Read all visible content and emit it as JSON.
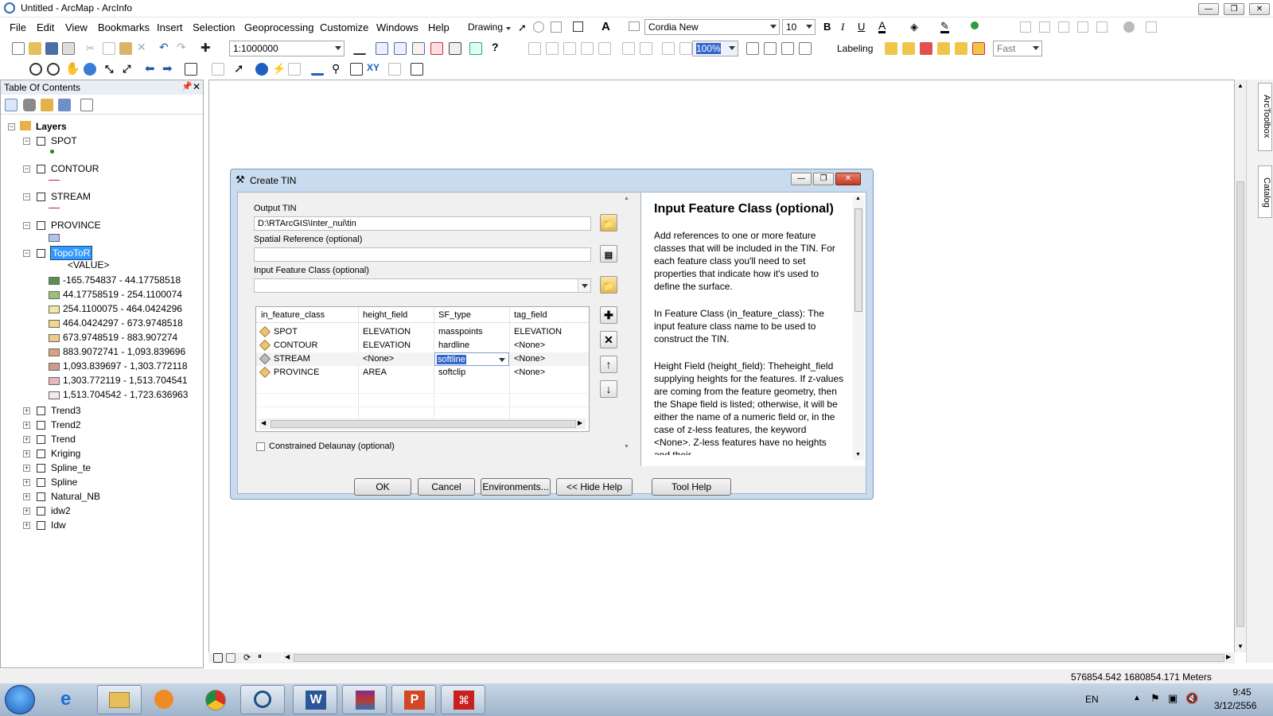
{
  "app": {
    "title": "Untitled - ArcMap - ArcInfo"
  },
  "menu": [
    "File",
    "Edit",
    "View",
    "Bookmarks",
    "Insert",
    "Selection",
    "Geoprocessing",
    "Customize",
    "Windows",
    "Help"
  ],
  "toolbar": {
    "drawing_label": "Drawing",
    "font_name": "Cordia New",
    "font_size": "10",
    "scale": "1:1000000",
    "zoom_pct": "100%",
    "labeling_label": "Labeling",
    "label_speed": "Fast"
  },
  "toc": {
    "title": "Table Of Contents",
    "root": "Layers",
    "layers": [
      {
        "name": "SPOT",
        "expanded": true,
        "sym_color": "#2e7d32"
      },
      {
        "name": "CONTOUR",
        "expanded": true,
        "sym_color": "#c2185b"
      },
      {
        "name": "STREAM",
        "expanded": true,
        "sym_color": "#c2185b"
      },
      {
        "name": "PROVINCE",
        "expanded": true,
        "sym_color": "#b3c3ef"
      },
      {
        "name": "TopoToR",
        "expanded": true,
        "selected": true
      }
    ],
    "value_header": "<VALUE>",
    "classes": [
      {
        "label": "-165.754837 - 44.17758518",
        "color": "#5e8f4b"
      },
      {
        "label": "44.17758519 - 254.1100074",
        "color": "#9ec17a"
      },
      {
        "label": "254.1100075 - 464.0424296",
        "color": "#f1e79e"
      },
      {
        "label": "464.0424297 - 673.9748518",
        "color": "#f2d98a"
      },
      {
        "label": "673.9748519 - 883.907274",
        "color": "#eecb8a"
      },
      {
        "label": "883.9072741 - 1,093.839696",
        "color": "#d9a27a"
      },
      {
        "label": "1,093.839697 - 1,303.772118",
        "color": "#cc9c8f"
      },
      {
        "label": "1,303.772119 - 1,513.704541",
        "color": "#e7b7bf"
      },
      {
        "label": "1,513.704542 - 1,723.636963",
        "color": "#f7e8ee"
      }
    ],
    "collapsed_layers": [
      "Trend3",
      "Trend2",
      "Trend",
      "Kriging",
      "Spline_te",
      "Spline",
      "Natural_NB",
      "idw2",
      "Idw"
    ]
  },
  "dialog": {
    "title": "Create TIN",
    "output_tin_label": "Output TIN",
    "output_tin_value": "D:\\RTArcGIS\\Inter_nui\\tin",
    "spatial_ref_label": "Spatial Reference (optional)",
    "spatial_ref_value": "",
    "input_fc_label": "Input Feature Class (optional)",
    "input_fc_value": "",
    "table": {
      "headers": [
        "in_feature_class",
        "height_field",
        "SF_type",
        "tag_field"
      ],
      "rows": [
        [
          "SPOT",
          "ELEVATION",
          "masspoints",
          "ELEVATION"
        ],
        [
          "CONTOUR",
          "ELEVATION",
          "hardline",
          "<None>"
        ],
        [
          "STREAM",
          "<None>",
          "softline",
          "<None>"
        ],
        [
          "PROVINCE",
          "AREA",
          "softclip",
          "<None>"
        ]
      ]
    },
    "constrained_label": "Constrained Delaunay (optional)",
    "buttons": {
      "ok": "OK",
      "cancel": "Cancel",
      "env": "Environments...",
      "hide_help": "<< Hide Help",
      "tool_help": "Tool Help"
    },
    "help": {
      "title": "Input Feature Class (optional)",
      "p1": "Add references to one or more feature classes that will be included in the TIN. For each feature class you'll need to set properties that indicate how it's used to define the surface.",
      "p2": "In Feature Class (in_feature_class): The input feature class name to be used to construct the TIN.",
      "p3": "Height Field (height_field): Theheight_field supplying heights for the features. If z-values are coming from the feature geometry, then the Shape field is listed; otherwise, it will be either the name of a numeric field or, in the case of z-less features, the keyword <None>. Z-less features have no heights and their"
    }
  },
  "side_tabs": {
    "toolbox": "ArcToolbox",
    "catalog": "Catalog"
  },
  "status": {
    "coords": "576854.542  1680854.171 Meters"
  },
  "taskbar": {
    "lang": "EN",
    "time": "9:45",
    "date": "3/12/2556"
  }
}
